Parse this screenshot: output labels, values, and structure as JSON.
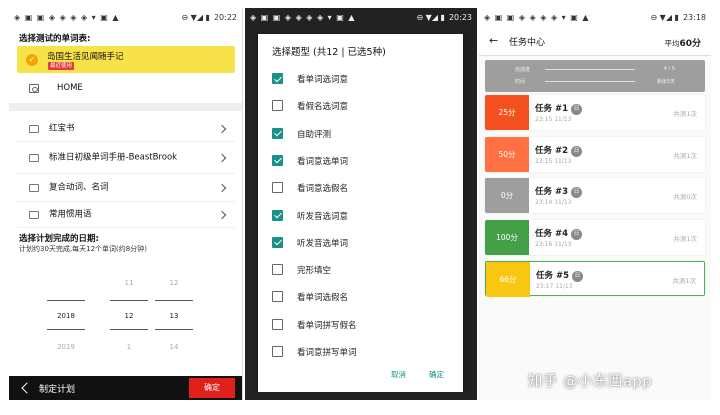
{
  "screen1": {
    "status": {
      "time": "20:22"
    },
    "title": "选择测试的单词表:",
    "selected": {
      "name": "岛国生活见闻随手记",
      "tag": "最近使用"
    },
    "home": "HOME",
    "lists": [
      "红宝书",
      "标准日初级单词手册-BeastBrook",
      "复合动词、名词",
      "常用惯用语"
    ],
    "plan_title": "选择计划完成的日期:",
    "plan_sub": "计划约30天完成,每天12个单词(约8分钟)",
    "picker": {
      "year": [
        "",
        "2018",
        "2019"
      ],
      "month": [
        "11",
        "12",
        "1"
      ],
      "day": [
        "12",
        "13",
        "14"
      ]
    },
    "bottom": {
      "title": "制定计划",
      "ok": "确定"
    }
  },
  "screen2": {
    "status": {
      "time": "20:23"
    },
    "dialog_title": "选择题型 (共12 | 已选5种)",
    "options": [
      {
        "label": "看单词选词意",
        "checked": true
      },
      {
        "label": "看假名选词意",
        "checked": false
      },
      {
        "label": "自助评测",
        "checked": true
      },
      {
        "label": "看词意选单词",
        "checked": true
      },
      {
        "label": "看词意选假名",
        "checked": false
      },
      {
        "label": "听发音选词意",
        "checked": true
      },
      {
        "label": "听发音选单词",
        "checked": true
      },
      {
        "label": "完形填空",
        "checked": false
      },
      {
        "label": "看单词选假名",
        "checked": false
      },
      {
        "label": "看单词拼写假名",
        "checked": false
      },
      {
        "label": "看词意拼写单词",
        "checked": false
      }
    ],
    "cancel": "取消",
    "ok": "确定"
  },
  "screen3": {
    "status": {
      "time": "23:18"
    },
    "title": "任务中心",
    "avg_label": "平均",
    "avg_value": "60分",
    "summary": {
      "done_label": "完成度",
      "done_value": "4 / 5",
      "time_label": "时间",
      "time_value": "剩余5天"
    },
    "badge": "日",
    "tasks": [
      {
        "score": "25分",
        "name": "任务 #1",
        "time": "23:15 11/13",
        "count": "共测1次",
        "color": "#f4511e"
      },
      {
        "score": "50分",
        "name": "任务 #2",
        "time": "23:15 11/13",
        "count": "共测1次",
        "color": "#ff7043"
      },
      {
        "score": "0分",
        "name": "任务 #3",
        "time": "23:14 11/13",
        "count": "共测0次",
        "color": "#9e9e9e"
      },
      {
        "score": "100分",
        "name": "任务 #4",
        "time": "23:16 11/13",
        "count": "共测1次",
        "color": "#43a047"
      },
      {
        "score": "66分",
        "name": "任务 #5",
        "time": "23:17 11/13",
        "count": "共测1次",
        "color": "#f9c712"
      }
    ]
  },
  "watermark": "知乎 @小东西app"
}
